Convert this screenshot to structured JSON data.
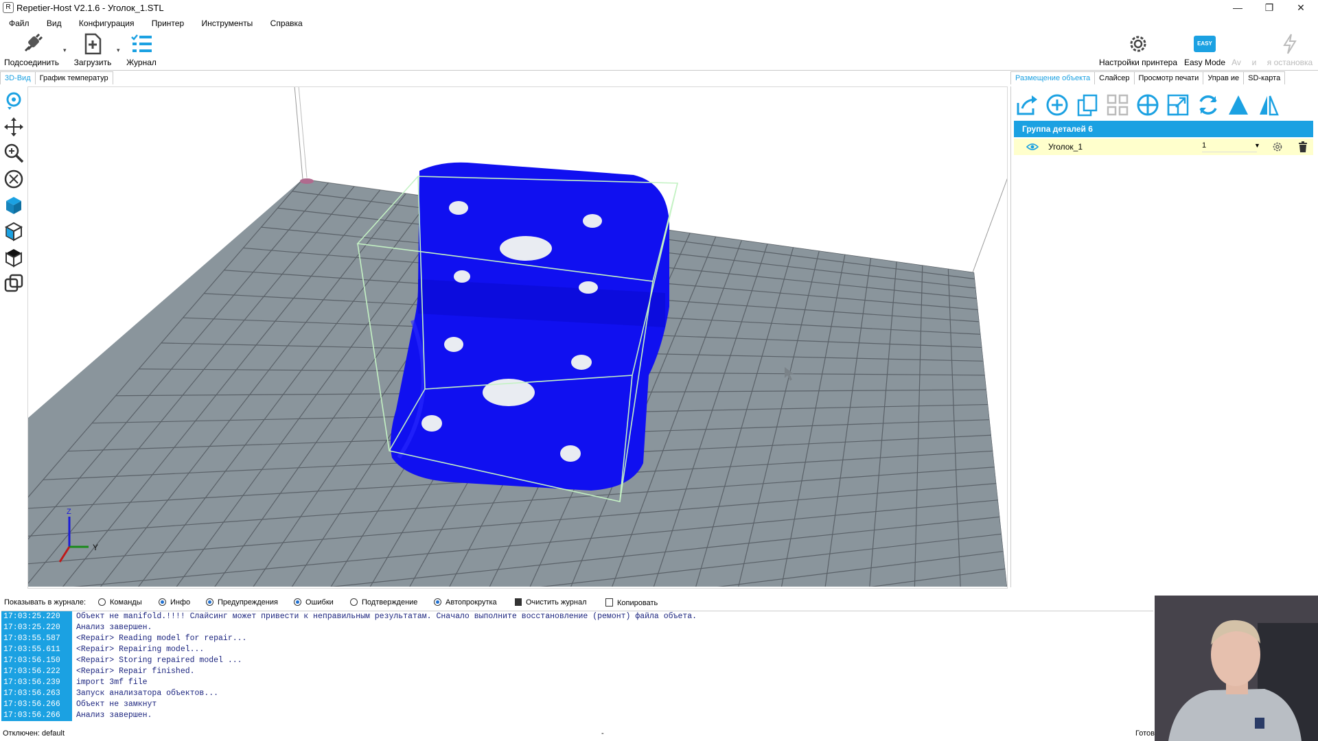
{
  "window": {
    "title": "Repetier-Host V2.1.6 - Уголок_1.STL",
    "minimize": "—",
    "restore": "❐",
    "close": "✕"
  },
  "menu": [
    "Файл",
    "Вид",
    "Конфигурация",
    "Принтер",
    "Инструменты",
    "Справка"
  ],
  "toolbar": {
    "connect": "Подсоединить",
    "load": "Загрузить",
    "log": "Журнал",
    "printer_settings": "Настройки принтера",
    "easy_mode": "Easy Mode",
    "easy_badge": "EASY",
    "dim_a": "Av",
    "dim_b": "и",
    "emergency_stop": "я остановка"
  },
  "left_tabs": [
    "3D-Вид",
    "График температур"
  ],
  "right_tabs": [
    "Размещение объекта",
    "Слайсер",
    "Просмотр печати",
    "Управ   ие",
    "SD-карта"
  ],
  "object_panel": {
    "group_header": "Группа деталей 6",
    "object_name": "Уголок_1",
    "copies": "1"
  },
  "log_options": {
    "label": "Показывать в журнале:",
    "commands": "Команды",
    "info": "Инфо",
    "warnings": "Предупреждения",
    "errors": "Ошибки",
    "acks": "Подтверждение",
    "autoscroll": "Автопрокрутка",
    "clear": "Очистить журнал",
    "copy": "Копировать"
  },
  "log_entries": [
    {
      "time": "17:03:25.220",
      "msg": "Объект не manifold.!!!! Слайсинг может привести к неправильным результатам. Сначало выполните восстановление (ремонт) файла объета."
    },
    {
      "time": "17:03:25.220",
      "msg": "Анализ завершен."
    },
    {
      "time": "17:03:55.587",
      "msg": "<Repair> Reading model for repair..."
    },
    {
      "time": "17:03:55.611",
      "msg": "<Repair> Repairing model..."
    },
    {
      "time": "17:03:56.150",
      "msg": "<Repair> Storing repaired model ..."
    },
    {
      "time": "17:03:56.222",
      "msg": "<Repair> Repair finished."
    },
    {
      "time": "17:03:56.239",
      "msg": "import 3mf file"
    },
    {
      "time": "17:03:56.263",
      "msg": "Запуск анализатора объектов..."
    },
    {
      "time": "17:03:56.266",
      "msg": "Объект не замкнут"
    },
    {
      "time": "17:03:56.266",
      "msg": "Анализ завершен."
    }
  ],
  "status": {
    "left": "Отключен: default",
    "mid": "-",
    "right": "Готов"
  },
  "axes": {
    "z": "Z",
    "y": "Y"
  },
  "colors": {
    "accent": "#1ba1e2",
    "model": "#1010f0",
    "bed": "#8a959c",
    "grid": "#5a6168"
  }
}
